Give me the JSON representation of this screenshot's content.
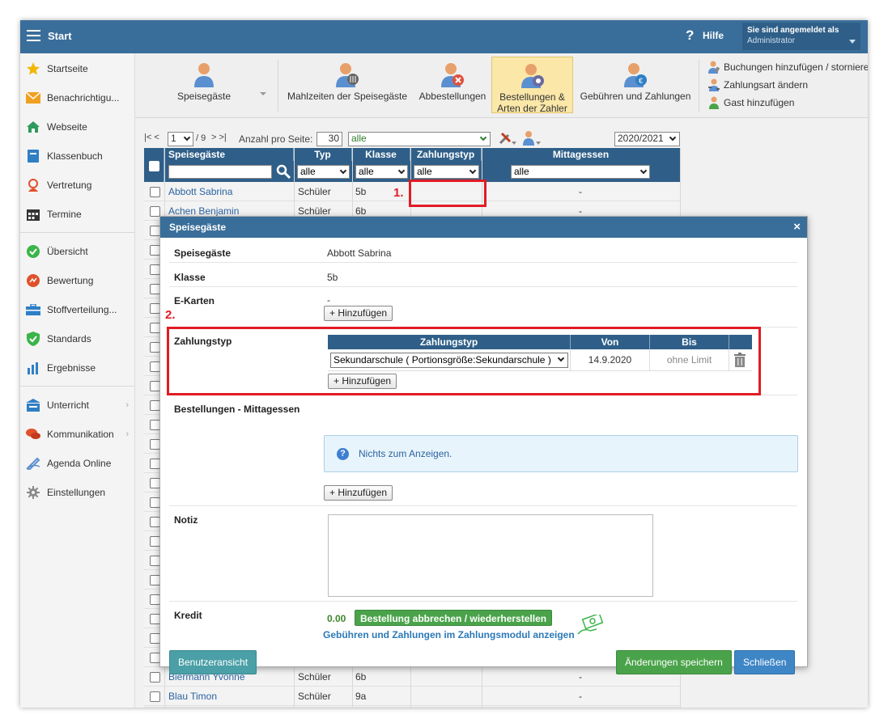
{
  "topbar": {
    "title": "Start",
    "help_label": "Hilfe",
    "login_line1": "Sie sind angemeldet als",
    "login_user": "Administrator"
  },
  "sidebar": {
    "items": [
      {
        "label": "Startseite",
        "icon": "star-icon"
      },
      {
        "label": "Benachrichtigu...",
        "icon": "envelope-icon"
      },
      {
        "label": "Webseite",
        "icon": "home-icon"
      },
      {
        "label": "Klassenbuch",
        "icon": "book-icon"
      },
      {
        "label": "Vertretung",
        "icon": "substitute-icon"
      },
      {
        "label": "Termine",
        "icon": "calendar-icon"
      },
      {
        "label": "Übersicht",
        "icon": "check-circle-icon"
      },
      {
        "label": "Bewertung",
        "icon": "rating-icon"
      },
      {
        "label": "Stoffverteilung...",
        "icon": "briefcase-icon"
      },
      {
        "label": "Standards",
        "icon": "shield-icon"
      },
      {
        "label": "Ergebnisse",
        "icon": "bar-chart-icon"
      },
      {
        "label": "Unterricht",
        "icon": "classroom-icon"
      },
      {
        "label": "Kommunikation",
        "icon": "chat-icon"
      },
      {
        "label": "Agenda Online",
        "icon": "pen-icon"
      },
      {
        "label": "Einstellungen",
        "icon": "gear-icon"
      }
    ]
  },
  "toolbar": {
    "speisegaeste": "Speisegäste",
    "mahlzeiten": "Mahlzeiten der Speisegäste",
    "abbestellungen": "Abbestellungen",
    "bestellungen_line1": "Bestellungen &",
    "bestellungen_line2": "Arten der Zahler",
    "gebuehren": "Gebühren und Zahlungen",
    "actions": [
      "Buchungen hinzufügen / stornieren",
      "Zahlungsart ändern",
      "Gast hinzufügen"
    ]
  },
  "list": {
    "pager_first": "|<",
    "pager_prev": "<",
    "page_value": "1",
    "page_total": "/ 9",
    "pager_next": ">",
    "pager_last": ">|",
    "per_page_label": "Anzahl pro Seite:",
    "per_page_value": "30",
    "filter_value": "alle",
    "year_value": "2020/2021",
    "columns": [
      "Speisegäste",
      "Typ",
      "Klasse",
      "Zahlungstyp",
      "Mittagessen"
    ],
    "filter_alle": "alle",
    "rows": [
      {
        "name": "Abbott Sabrina",
        "typ": "Schüler",
        "klasse": "5b",
        "mittag": "-"
      },
      {
        "name": "Achen Benjamin",
        "typ": "Schüler",
        "klasse": "6b",
        "mittag": "-"
      },
      {
        "name": "Biermann Yvonne",
        "typ": "Schüler",
        "klasse": "6b",
        "mittag": "-"
      },
      {
        "name": "Blau Timon",
        "typ": "Schüler",
        "klasse": "9a",
        "mittag": "-"
      }
    ]
  },
  "annotations": {
    "one": "1.",
    "two": "2."
  },
  "modal": {
    "title": "Speisegäste",
    "close": "×",
    "speisegaeste_label": "Speisegäste",
    "speisegaeste_value": "Abbott Sabrina",
    "klasse_label": "Klasse",
    "klasse_value": "5b",
    "ekarten_label": "E-Karten",
    "ekarten_value": "-",
    "add_label": "+ Hinzufügen",
    "zahlungstyp_label": "Zahlungstyp",
    "zt_columns": [
      "Zahlungstyp",
      "Von",
      "Bis"
    ],
    "zt_type": "Sekundarschule ( Portionsgröße:Sekundarschule )",
    "zt_von": "14.9.2020",
    "zt_bis": "ohne Limit",
    "bestellungen_label": "Bestellungen - Mittagessen",
    "nothing_text": "Nichts zum Anzeigen.",
    "notiz_label": "Notiz",
    "kredit_label": "Kredit",
    "kredit_value": "0.00",
    "cancel_restore": "Bestellung abbrechen / wiederherstellen",
    "fees_link": "Gebühren und Zahlungen im Zahlungsmodul anzeigen",
    "user_view": "Benutzeransicht",
    "save": "Änderungen speichern",
    "close_btn": "Schließen"
  },
  "colors": {
    "header_blue": "#3a6e9a",
    "table_header": "#2f5f88",
    "highlight_red": "#e21b24",
    "save_green": "#4aa34a",
    "active_tool": "#fbe7a8"
  }
}
